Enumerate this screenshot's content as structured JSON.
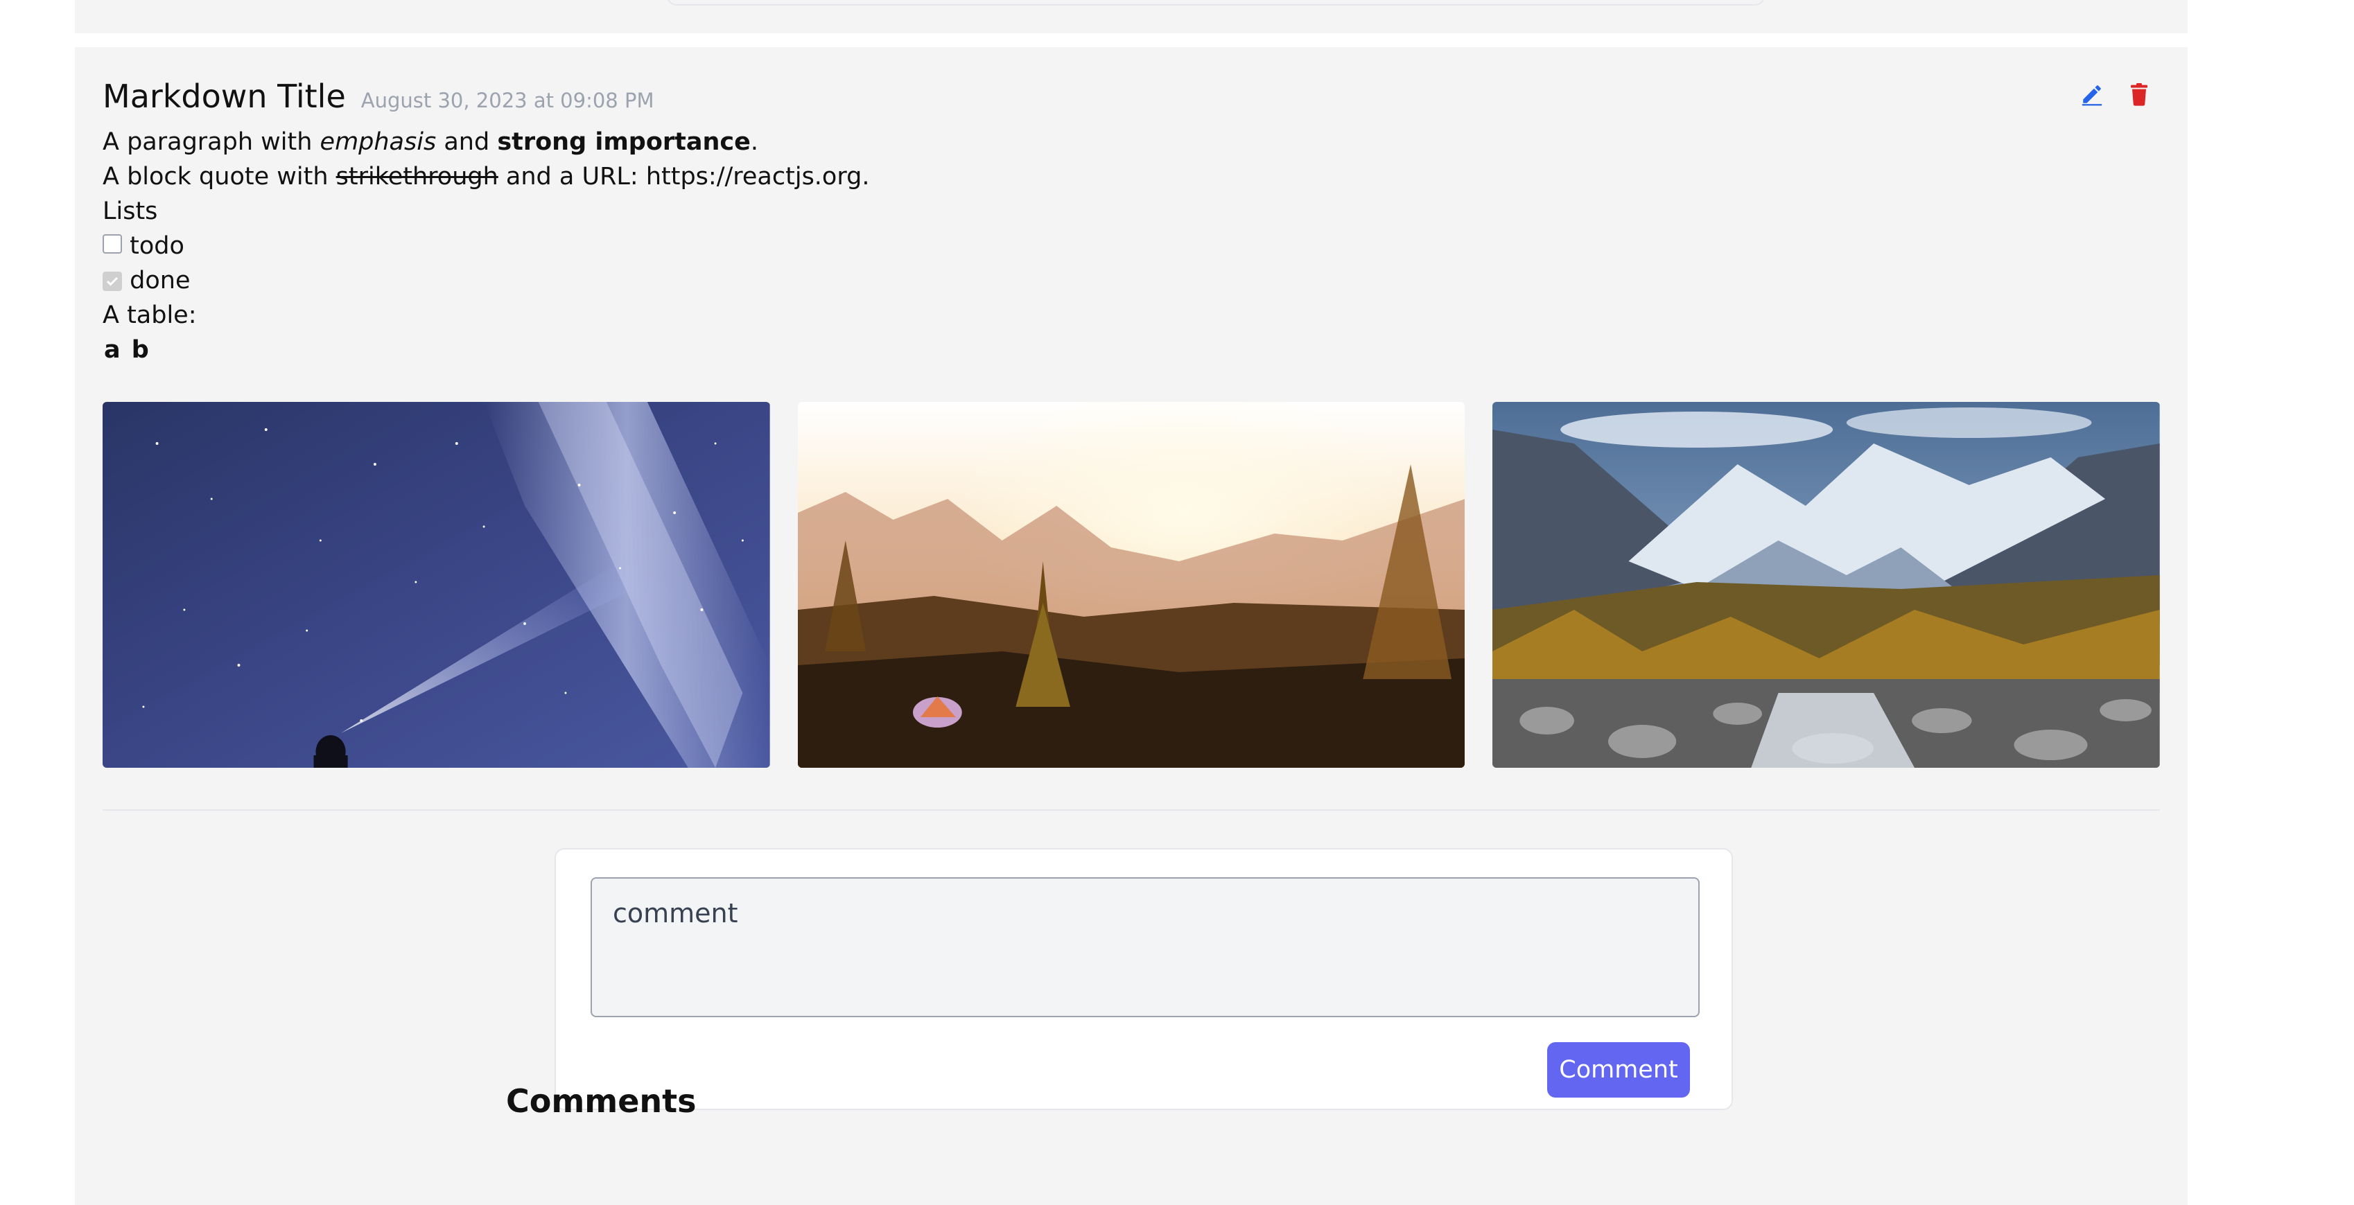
{
  "post": {
    "title": "Markdown Title",
    "date": "August 30, 2023 at 09:08 PM",
    "paragraph": {
      "prefix": "A paragraph with ",
      "emphasis": "emphasis",
      "middle": " and ",
      "strong": "strong importance",
      "suffix": "."
    },
    "quote": {
      "prefix": "A block quote with ",
      "strike": "strikethrough",
      "suffix": " and a URL: https://reactjs.org."
    },
    "lists_label": "Lists",
    "tasks": [
      {
        "label": "todo",
        "checked": false
      },
      {
        "label": "done",
        "checked": true
      }
    ],
    "table_label": "A table:",
    "table_header": "a b",
    "images": [
      "milky-way-night-sky-photo",
      "mountain-sunset-tent-photo",
      "alpine-river-valley-photo"
    ]
  },
  "actions": {
    "edit_icon": "pencil-icon",
    "delete_icon": "trash-icon",
    "edit_color": "#2563eb",
    "delete_color": "#dc2626"
  },
  "comment_form": {
    "placeholder": "comment",
    "submit_label": "Comment",
    "accent": "#6366f1"
  },
  "comments": {
    "heading": "Comments"
  }
}
